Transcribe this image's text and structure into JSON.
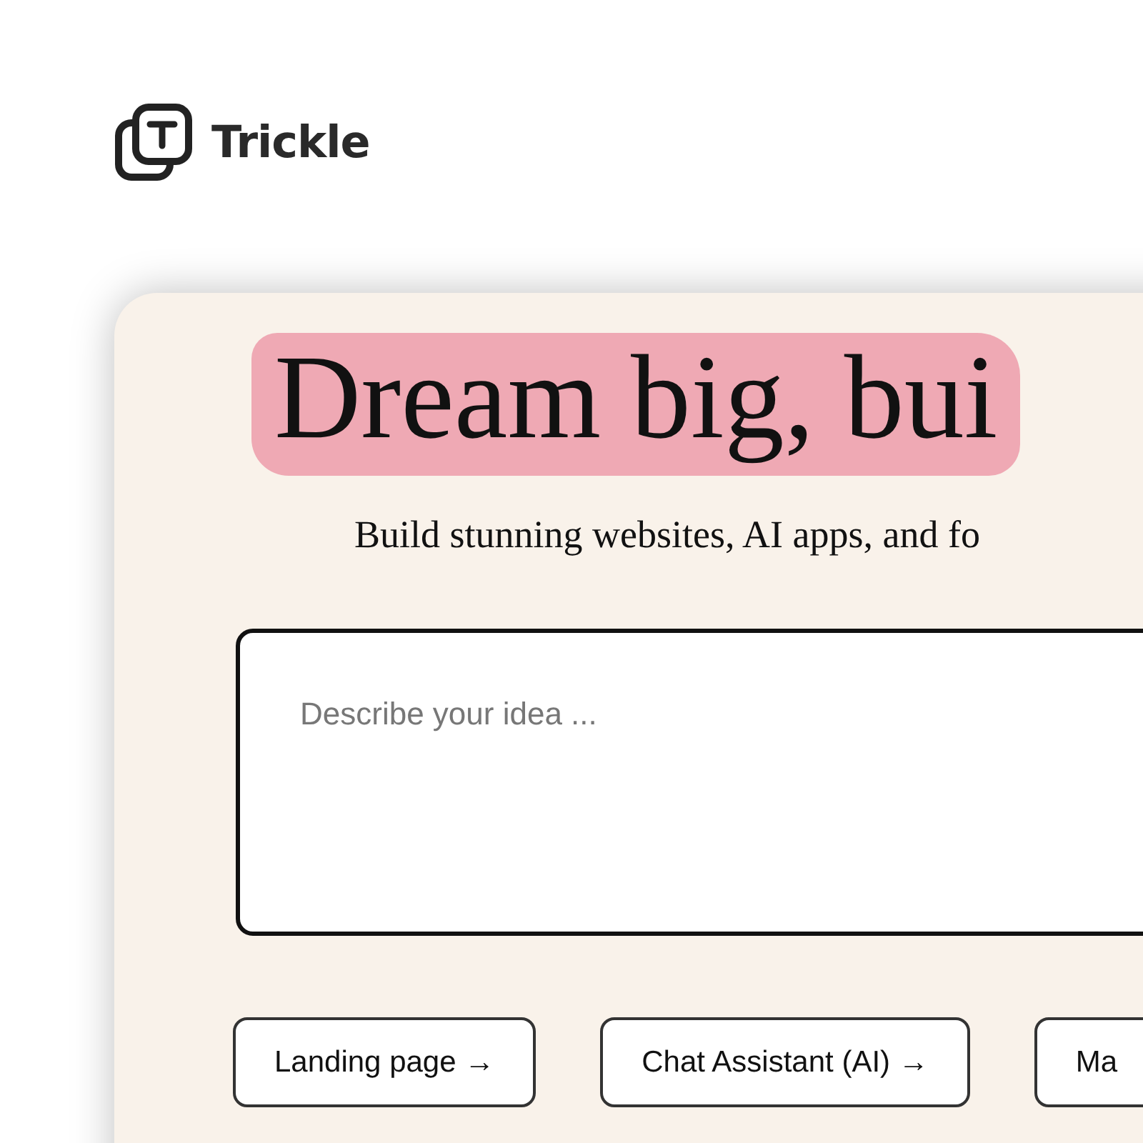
{
  "brand": {
    "name": "Trickle"
  },
  "hero": {
    "title": "Dream big, bui",
    "subtitle": "Build stunning websites, AI apps, and fo"
  },
  "prompt": {
    "placeholder": "Describe your idea ..."
  },
  "suggestions": [
    "Landing page →",
    "Chat Assistant (AI) →",
    "Ma"
  ]
}
